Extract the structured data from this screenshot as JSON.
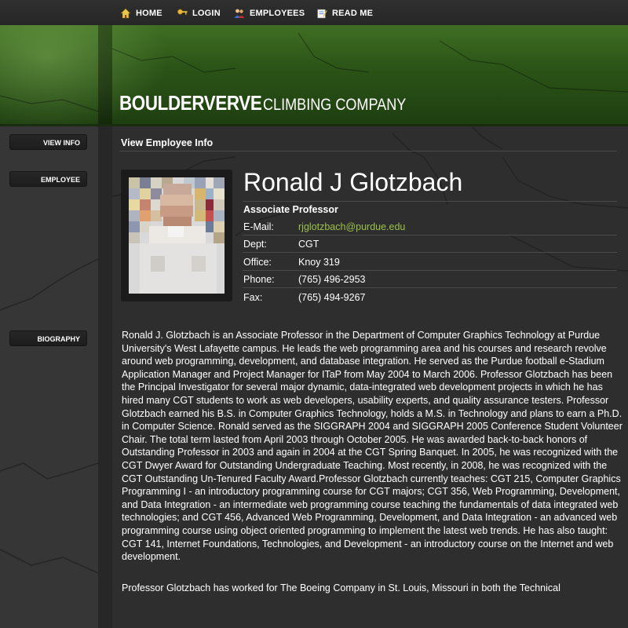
{
  "nav": {
    "items": [
      {
        "label": "HOME",
        "icon": "home-icon"
      },
      {
        "label": "LOGIN",
        "icon": "key-icon"
      },
      {
        "label": "EMPLOYEES",
        "icon": "users-icon"
      },
      {
        "label": "READ ME",
        "icon": "document-icon"
      }
    ]
  },
  "banner": {
    "logo_main": "BOULDERVERVE",
    "logo_sub": "CLIMBING COMPANY"
  },
  "sidebar": {
    "view_info": "VIEW INFO",
    "employee": "EMPLOYEE",
    "biography": "BIOGRAPHY"
  },
  "main": {
    "section_title": "View Employee Info"
  },
  "employee": {
    "name": "Ronald J Glotzbach",
    "title": "Associate Professor",
    "fields": [
      {
        "label": "E-Mail:",
        "value": "rjglotzbach@purdue.edu"
      },
      {
        "label": "Dept:",
        "value": "CGT"
      },
      {
        "label": "Office:",
        "value": "Knoy 319"
      },
      {
        "label": "Phone:",
        "value": "(765) 496-2953"
      },
      {
        "label": "Fax:",
        "value": "(765) 494-9267"
      }
    ]
  },
  "bio": {
    "paragraphs": [
      "Ronald J. Glotzbach is an Associate Professor in the Department of Computer Graphics Technology at Purdue University's West Lafayette campus. He leads the web programming area and his courses and research revolve around web programming, development, and database integration. He served as the Purdue football e-Stadium Application Manager and Project Manager for ITaP from May 2004 to March 2006. Professor Glotzbach has been the Principal Investigator for several major dynamic, data-integrated web development projects in which he has hired many CGT students to work as web developers, usability experts, and quality assurance testers. Professor Glotzbach earned his B.S. in Computer Graphics Technology, holds a M.S. in Technology and plans to earn a Ph.D. in Computer Science. Ronald served as the SIGGRAPH 2004 and SIGGRAPH 2005 Conference Student Volunteer Chair. The total term lasted from April 2003 through October 2005. He was awarded back-to-back honors of Outstanding Professor in 2003 and again in 2004 at the CGT Spring Banquet. In 2005, he was recognized with the CGT Dwyer Award for Outstanding Undergraduate Teaching. Most recently, in 2008, he was recognized with the CGT Outstanding Un-Tenured Faculty Award.Professor Glotzbach currently teaches: CGT 215, Computer Graphics Programming I - an introductory programming course for CGT majors; CGT 356, Web Programming, Development, and Data Integration - an intermediate web programming course teaching the fundamentals of data integrated web technologies; and CGT 456, Advanced Web Programming, Development, and Data Integration - an advanced web programming course using object oriented programming to implement the latest web trends. He has also taught: CGT 141, Internet Foundations, Technologies, and Development - an introductory course on the Internet and web development.",
      "Professor Glotzbach has worked for The Boeing Company in St. Louis, Missouri in both the Technical"
    ]
  },
  "colors": {
    "banner_green": "#2c5518",
    "link_green": "#9cc04a",
    "background": "#2e2e2e"
  }
}
